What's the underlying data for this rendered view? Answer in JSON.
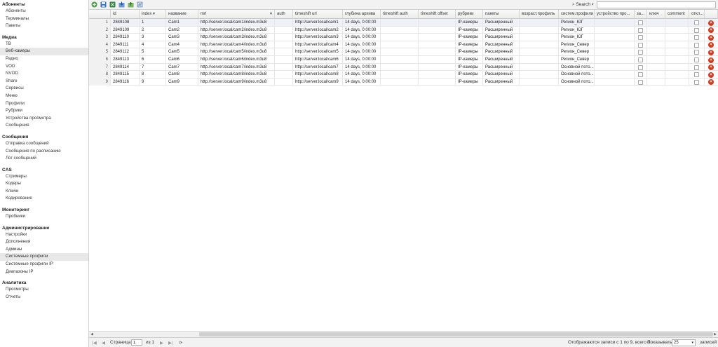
{
  "sidebar": {
    "sections": [
      {
        "title": "Абоненты",
        "items": [
          "Абоненты",
          "Терминалы",
          "Пакеты"
        ]
      },
      {
        "title": "Медиа",
        "items": [
          "ТВ",
          "Веб-камеры",
          "Радио",
          "VOD",
          "NVOD",
          "Share",
          "Сервисы",
          "Меню",
          "Профили",
          "Рубрики",
          "Устройства просмотра",
          "Сообщения"
        ]
      },
      {
        "title": "Сообщения",
        "items": [
          "Отправка сообщений",
          "Сообщения по расписанию",
          "Лог сообщений"
        ]
      },
      {
        "title": "CAS",
        "items": [
          "Стримеры",
          "Кодеры",
          "Ключи",
          "Кодирование"
        ]
      },
      {
        "title": "Мониторинг",
        "items": [
          "Пробники"
        ]
      },
      {
        "title": "Администрирование",
        "items": [
          "Настройки",
          "Дополнения",
          "Админы",
          "Системные профили",
          "Системные профили IP",
          "Диапазоны IP"
        ]
      },
      {
        "title": "Аналитика",
        "items": [
          "Просмотры",
          "Отчеты"
        ]
      }
    ],
    "active_items": [
      "Веб-камеры",
      "Системные профили"
    ]
  },
  "toolbar": {
    "search_label": "Search",
    "search_value": "",
    "icons": [
      "add-icon",
      "save-icon",
      "export-excel-icon",
      "import-icon",
      "upload-icon",
      "refresh-grid-icon"
    ]
  },
  "grid": {
    "columns": [
      "",
      "id",
      "index",
      "название",
      "mrl",
      "auth",
      "timeshift url",
      "глубина архива",
      "timeshift auth",
      "timeshift offset",
      "рубрики",
      "пакеты",
      "возраст.профиль",
      "систем.профили",
      "устройство про...",
      "за...",
      "ключ",
      "comment",
      "откл...",
      ""
    ],
    "sorted_column": "index",
    "rows": [
      {
        "n": "1",
        "id": "2849108",
        "index": "1",
        "name": "Cam1",
        "mrl": "http://server.local/cam1/index.m3u8",
        "ts_url": "http://server.local/cam1",
        "depth": "14 days, 0:00:00",
        "rubric": "IP-камеры",
        "package": "Расширенный",
        "sys_profile": "Регион_ЮГ"
      },
      {
        "n": "2",
        "id": "2849109",
        "index": "2",
        "name": "Cam2",
        "mrl": "http://server.local/cam2/index.m3u8",
        "ts_url": "http://server.local/cam2",
        "depth": "14 days, 0:00:00",
        "rubric": "IP-камеры",
        "package": "Расширенный",
        "sys_profile": "Регион_ЮГ"
      },
      {
        "n": "3",
        "id": "2849110",
        "index": "3",
        "name": "Cam3",
        "mrl": "http://server.local/cam3/index.m3u8",
        "ts_url": "http://server.local/cam3",
        "depth": "14 days, 0:00:00",
        "rubric": "IP-камеры",
        "package": "Расширенный",
        "sys_profile": "Регион_ЮГ"
      },
      {
        "n": "4",
        "id": "2849111",
        "index": "4",
        "name": "Cam4",
        "mrl": "http://server.local/cam4/index.m3u8",
        "ts_url": "http://server.local/cam4",
        "depth": "14 days, 0:00:00",
        "rubric": "IP-камеры",
        "package": "Расширенный",
        "sys_profile": "Регион_Север"
      },
      {
        "n": "5",
        "id": "2849112",
        "index": "5",
        "name": "Cam5",
        "mrl": "http://server.local/cam5/index.m3u8",
        "ts_url": "http://server.local/cam5",
        "depth": "14 days, 0:00:00",
        "rubric": "IP-камеры",
        "package": "Расширенный",
        "sys_profile": "Регион_Север"
      },
      {
        "n": "6",
        "id": "2849113",
        "index": "6",
        "name": "Cam6",
        "mrl": "http://server.local/cam6/index.m3u8",
        "ts_url": "http://server.local/cam6",
        "depth": "14 days, 0:00:00",
        "rubric": "IP-камеры",
        "package": "Расширенный",
        "sys_profile": "Регион_Север"
      },
      {
        "n": "7",
        "id": "2849114",
        "index": "7",
        "name": "Cam7",
        "mrl": "http://server.local/cam7/index.m3u8",
        "ts_url": "http://server.local/cam7",
        "depth": "14 days, 0:00:00",
        "rubric": "IP-камеры",
        "package": "Расширенный",
        "sys_profile": "Основной пото..."
      },
      {
        "n": "8",
        "id": "2849115",
        "index": "8",
        "name": "Cam8",
        "mrl": "http://server.local/cam8/index.m3u8",
        "ts_url": "http://server.local/cam8",
        "depth": "14 days, 0:00:00",
        "rubric": "IP-камеры",
        "package": "Расширенный",
        "sys_profile": "Основной пото..."
      },
      {
        "n": "9",
        "id": "2849116",
        "index": "9",
        "name": "Cam9",
        "mrl": "http://server.local/cam9/index.m3u8",
        "ts_url": "http://server.local/cam9",
        "depth": "14 days, 0:00:00",
        "rubric": "IP-камеры",
        "package": "Расширенный",
        "sys_profile": "Основной пото..."
      }
    ]
  },
  "pager": {
    "page_label": "Страница",
    "page_value": "1",
    "of_label": "из 1",
    "records_info": "Отображаются записи с 1 по 9, всего 9",
    "show_label": "Показывать",
    "rows_per_page": "25",
    "records_label": "записей"
  },
  "colors": {
    "add": "#3aa83a",
    "delete": "#d23a1f",
    "active_row": "#eef2f8",
    "active_sidebar": "#e8e8e8"
  }
}
